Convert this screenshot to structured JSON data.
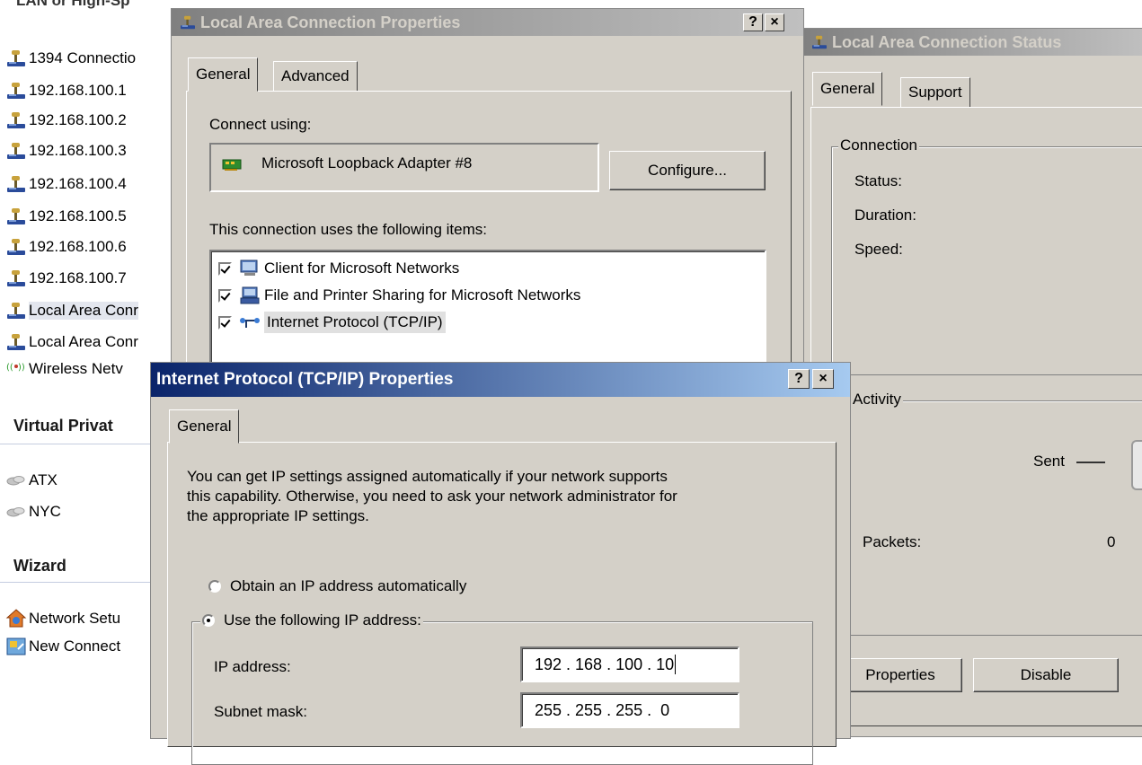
{
  "explorer": {
    "cut_header": "LAN or High-Sp",
    "items": [
      {
        "label": "1394 Connectio",
        "icon": "network-connection-icon"
      },
      {
        "label": "192.168.100.1",
        "icon": "network-connection-icon"
      },
      {
        "label": "192.168.100.2",
        "icon": "network-connection-icon"
      },
      {
        "label": "192.168.100.3",
        "icon": "network-connection-icon"
      },
      {
        "label": "192.168.100.4",
        "icon": "network-connection-icon"
      },
      {
        "label": "192.168.100.5",
        "icon": "network-connection-icon"
      },
      {
        "label": "192.168.100.6",
        "icon": "network-connection-icon"
      },
      {
        "label": "192.168.100.7",
        "icon": "network-connection-icon"
      },
      {
        "label": "Local Area Conr",
        "icon": "network-connection-icon"
      },
      {
        "label": "Local Area Conr",
        "icon": "network-connection-icon"
      },
      {
        "label": "Wireless Netv",
        "icon": "wireless-network-icon"
      }
    ],
    "vpn_header": "Virtual Privat",
    "vpn_items": [
      {
        "label": "ATX",
        "icon": "vpn-connection-icon"
      },
      {
        "label": "NYC",
        "icon": "vpn-connection-icon"
      }
    ],
    "wizard_header": "Wizard",
    "wizard_items": [
      {
        "label": "Network Setu",
        "icon": "network-setup-wizard-icon"
      },
      {
        "label": "New Connect",
        "icon": "new-connection-wizard-icon"
      }
    ]
  },
  "lac_props": {
    "title": "Local Area Connection Properties",
    "help_btn": "?",
    "close_btn": "×",
    "tabs": [
      "General",
      "Advanced"
    ],
    "connect_using_label": "Connect using:",
    "adapter_name": "Microsoft Loopback Adapter #8",
    "configure_btn": "Configure...",
    "items_label": "This connection uses the following items:",
    "items": [
      {
        "label": "Client for Microsoft Networks",
        "checked": true
      },
      {
        "label": "File and Printer Sharing for Microsoft Networks",
        "checked": true
      },
      {
        "label": "Internet Protocol (TCP/IP)",
        "checked": true
      }
    ]
  },
  "lac_status": {
    "title": "Local Area Connection Status",
    "tabs": [
      "General",
      "Support"
    ],
    "connection_group": "Connection",
    "status_label": "Status:",
    "duration_label": "Duration:",
    "speed_label": "Speed:",
    "activity_group": "Activity",
    "sent_label": "Sent",
    "packets_label": "Packets:",
    "packets_sent": "0",
    "properties_btn": "Properties",
    "disable_btn": "Disable"
  },
  "tcpip": {
    "title": "Internet Protocol (TCP/IP) Properties",
    "help_btn": "?",
    "close_btn": "×",
    "tab": "General",
    "description_lines": [
      "You can get IP settings assigned automatically if your network supports",
      "this capability. Otherwise, you need to ask your network administrator for",
      "the appropriate IP settings."
    ],
    "radio_auto": "Obtain an IP address automatically",
    "radio_manual": "Use the following IP address:",
    "selected_option": "manual",
    "ip_label": "IP address:",
    "ip_value": "192 . 168 . 100 . 10",
    "subnet_label": "Subnet mask:",
    "subnet_value": "255 . 255 . 255 .  0"
  },
  "colors": {
    "dialog_face": "#d4d0c8",
    "active_title_start": "#0a246a",
    "active_title_end": "#a6caf0",
    "inactive_title_start": "#808080"
  }
}
